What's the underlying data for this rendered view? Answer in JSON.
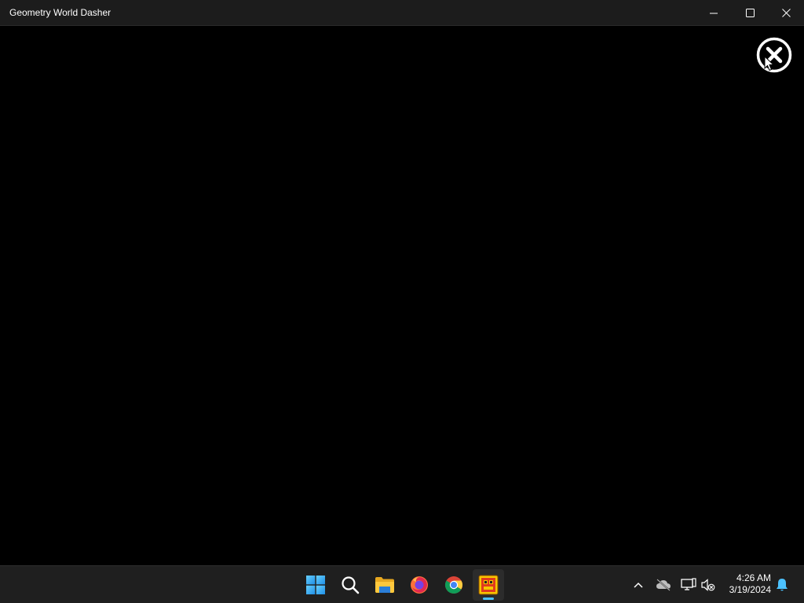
{
  "window": {
    "title": "Geometry World Dasher",
    "controls": {
      "minimize": "minimize-icon",
      "maximize": "maximize-icon",
      "close": "close-icon"
    }
  },
  "game": {
    "background_color": "#000000",
    "close_button_icon": "circle-x-icon"
  },
  "taskbar": {
    "background_color": "#1f1f1f",
    "apps": [
      {
        "name": "Start",
        "icon": "windows-start-icon"
      },
      {
        "name": "Search",
        "icon": "search-icon"
      },
      {
        "name": "File Explorer",
        "icon": "folder-icon"
      },
      {
        "name": "Firefox",
        "icon": "firefox-icon"
      },
      {
        "name": "Chrome",
        "icon": "chrome-icon"
      },
      {
        "name": "Geometry World Dasher",
        "icon": "geometry-dash-icon",
        "active": true
      }
    ],
    "active_indicator_color": "#4cc2ff",
    "tray": {
      "icons": [
        "chevron-up-icon",
        "cloud-off-icon",
        "network-icon",
        "volume-muted-icon"
      ],
      "time": "4:26 AM",
      "date": "3/19/2024",
      "notification_icon": "bell-icon",
      "notification_color": "#4cc2ff"
    }
  }
}
